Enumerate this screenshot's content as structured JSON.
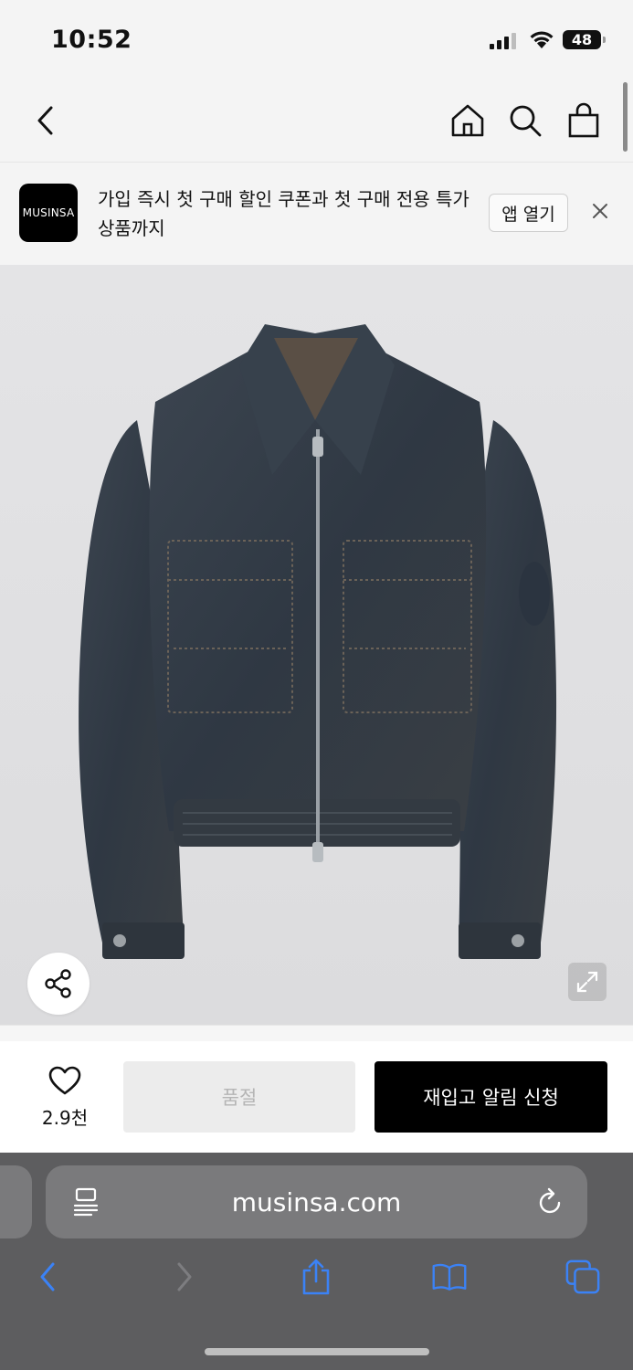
{
  "status_bar": {
    "time": "10:52",
    "battery": "48"
  },
  "banner": {
    "logo_text": "MUSINSA",
    "message": "가입 즉시 첫 구매 할인 쿠폰과 첫 구매 전용 특가 상품까지",
    "open_app_label": "앱 열기"
  },
  "product": {
    "image_description_icon": "denim-jacket-image"
  },
  "actions": {
    "like_count": "2.9천",
    "sold_out_label": "품절",
    "restock_alert_label": "재입고 알림 신청"
  },
  "browser": {
    "url": "musinsa.com"
  },
  "colors": {
    "accent_black": "#000000",
    "soldout_bg": "#ececec",
    "safari_blue": "#3b82f6",
    "safari_bar": "#5d5d5f"
  }
}
